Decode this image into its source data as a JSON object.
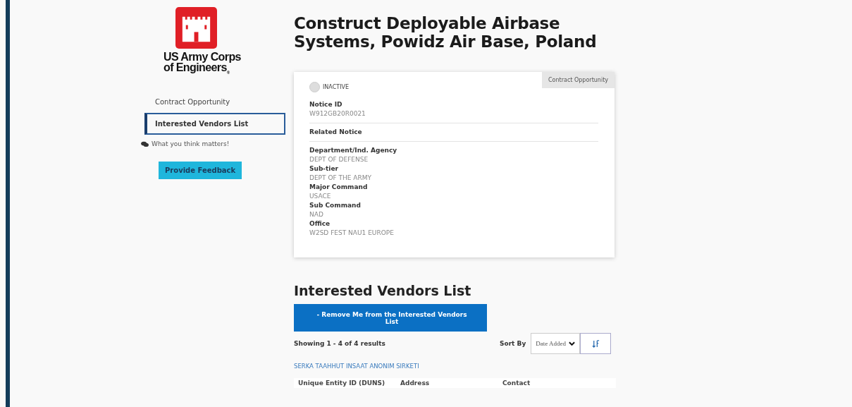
{
  "logo": {
    "text_line_1": "US Army Corps",
    "text_line_2": "of Engineers",
    "trademark": "®"
  },
  "sidebar": {
    "items": [
      {
        "label": "Contract Opportunity",
        "selected": false
      },
      {
        "label": "Interested Vendors List",
        "selected": true
      }
    ],
    "feedback_note": "What you think matters!",
    "feedback_button": "Provide Feedback"
  },
  "title": "Construct Deployable Airbase Systems, Powidz Air Base, Poland",
  "card": {
    "status": "INACTIVE",
    "active": false,
    "tag": "Contract Opportunity",
    "sections": [
      [
        {
          "label": "Notice ID",
          "value": "W912GB20R0021"
        }
      ],
      [
        {
          "label": "Related Notice"
        }
      ],
      [
        {
          "label": "Department/Ind. Agency",
          "value": "DEPT OF DEFENSE"
        },
        {
          "label": "Sub-tier",
          "value": "DEPT OF THE ARMY"
        },
        {
          "label": "Major Command",
          "value": "USACE"
        },
        {
          "label": "Sub Command",
          "value": "NAD"
        },
        {
          "label": "Office",
          "value": "W2SD FEST NAU1 EUROPE"
        }
      ]
    ]
  },
  "vendors": {
    "heading": "Interested Vendors List",
    "remove_button": "- Remove Me from the Interested Vendors List",
    "showing": "Showing 1 - 4 of 4 results",
    "sort_label": "Sort By",
    "sort_value": "Date Added",
    "items": [
      {
        "name": "SERKA TAAHHUT INSAAT ANONIM SIRKETI"
      }
    ],
    "table_columns": [
      "Unique Entity ID (DUNS)",
      "Address",
      "Contact"
    ]
  }
}
